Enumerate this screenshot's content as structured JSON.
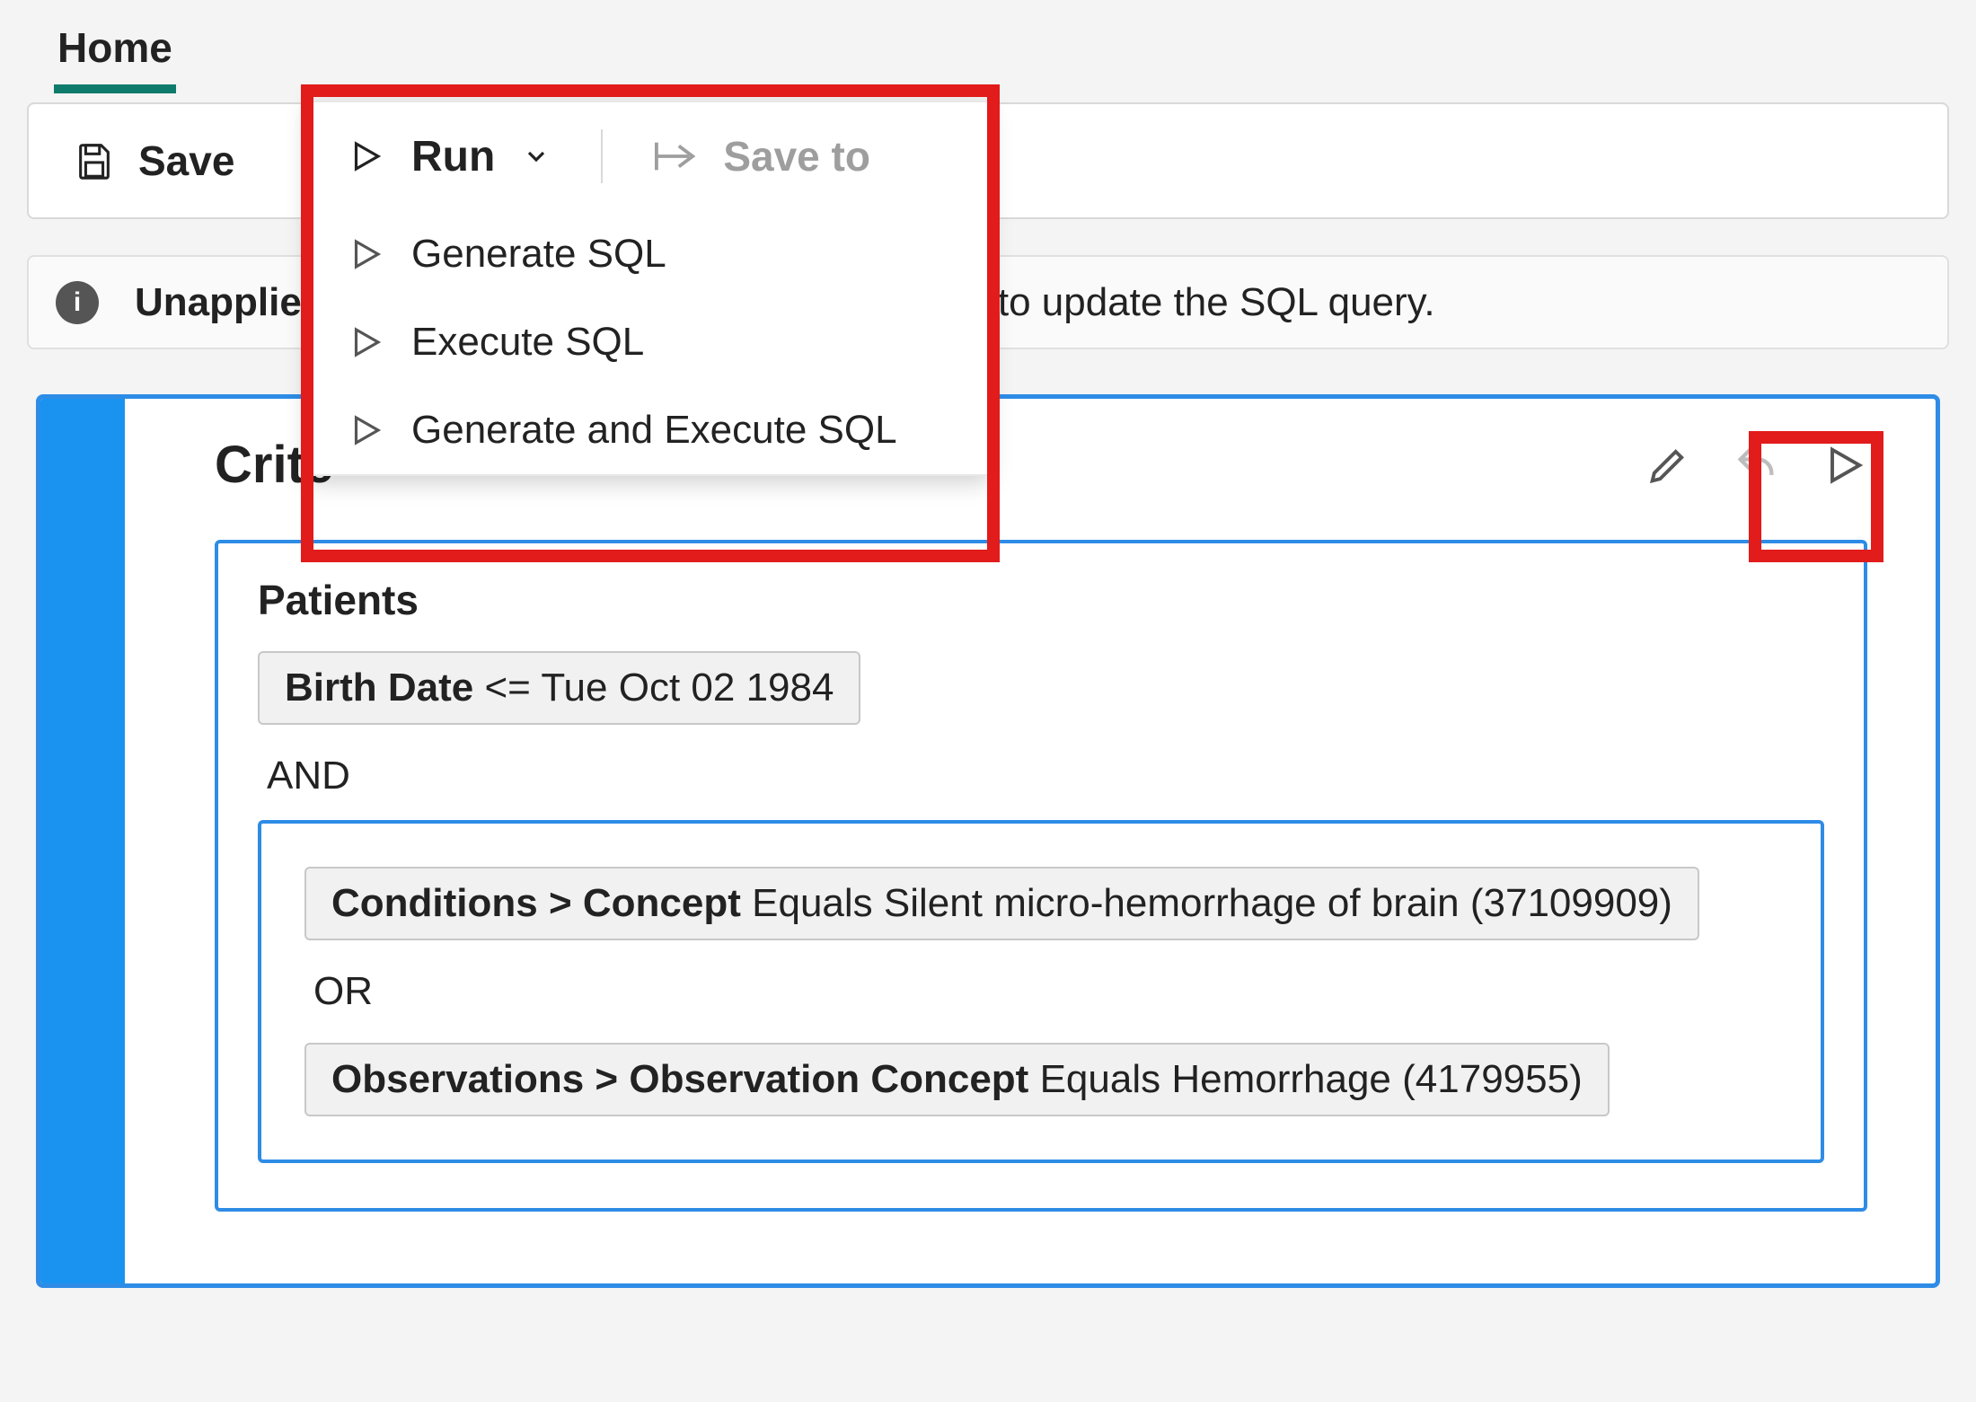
{
  "tabs": {
    "home": "Home"
  },
  "toolbar": {
    "save": "Save",
    "run": "Run",
    "save_to": "Save to"
  },
  "run_menu": {
    "items": [
      "Generate SQL",
      "Execute SQL",
      "Generate and Execute SQL"
    ]
  },
  "banner": {
    "prefix": "Unapplie",
    "suffix": "L to update the SQL query."
  },
  "criteria": {
    "title_visible": "Crite",
    "labels": {
      "patients": "Patients"
    },
    "birthdate": {
      "field": "Birth Date",
      "op": "<=",
      "value": "Tue Oct 02 1984"
    },
    "and_label": "AND",
    "or_label": "OR",
    "conditions": {
      "path": "Conditions > Concept",
      "op": "Equals",
      "value": "Silent micro-hemorrhage of brain (37109909)"
    },
    "observations": {
      "path": "Observations > Observation Concept",
      "op": "Equals",
      "value": "Hemorrhage (4179955)"
    }
  }
}
